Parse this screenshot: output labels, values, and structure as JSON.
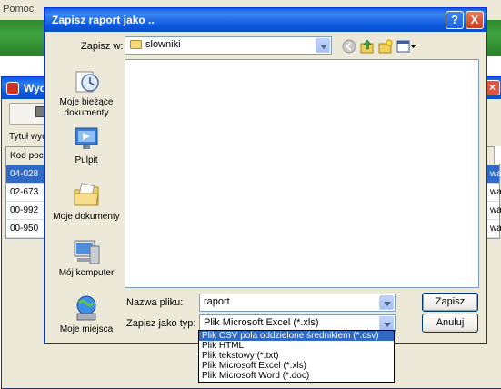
{
  "background_app": {
    "menu_item": "Pomoc",
    "window_title": "Wyd",
    "field_label": "Tytuł wyd",
    "table": {
      "header": "Kod pocz",
      "rows": [
        {
          "code": "04-028",
          "right": "wa"
        },
        {
          "code": "02-673",
          "right": "wa"
        },
        {
          "code": "00-992",
          "right": "wa"
        },
        {
          "code": "00-950",
          "right": "wa"
        }
      ]
    }
  },
  "dialog": {
    "title": "Zapisz raport jako ..",
    "help_label": "?",
    "close_label": "X",
    "save_in_label": "Zapisz w:",
    "save_in_value": "slowniki",
    "places": [
      {
        "label": "Moje bieżące dokumenty",
        "icon": "recent-documents-icon"
      },
      {
        "label": "Pulpit",
        "icon": "desktop-icon"
      },
      {
        "label": "Moje dokumenty",
        "icon": "my-documents-icon"
      },
      {
        "label": "Mój komputer",
        "icon": "my-computer-icon"
      },
      {
        "label": "Moje miejsca",
        "icon": "network-places-icon"
      }
    ],
    "filename_label": "Nazwa pliku:",
    "filename_value": "raport",
    "filetype_label": "Zapisz jako typ:",
    "filetype_value": "Plik Microsoft Excel (*.xls)",
    "save_button": "Zapisz",
    "cancel_button": "Anuluj",
    "filetype_options": [
      "Plik CSV pola oddzielone średnikiem (*.csv)",
      "Plik HTML",
      "Plik tekstowy (*.txt)",
      "Plik Microsoft Excel (*.xls)",
      "Plik Microsoft Word (*.doc)"
    ],
    "highlighted_option_index": 0
  },
  "colors": {
    "titlebar": "#0a5ce2",
    "selection": "#316ac5",
    "app_header": "#3ea33e"
  }
}
